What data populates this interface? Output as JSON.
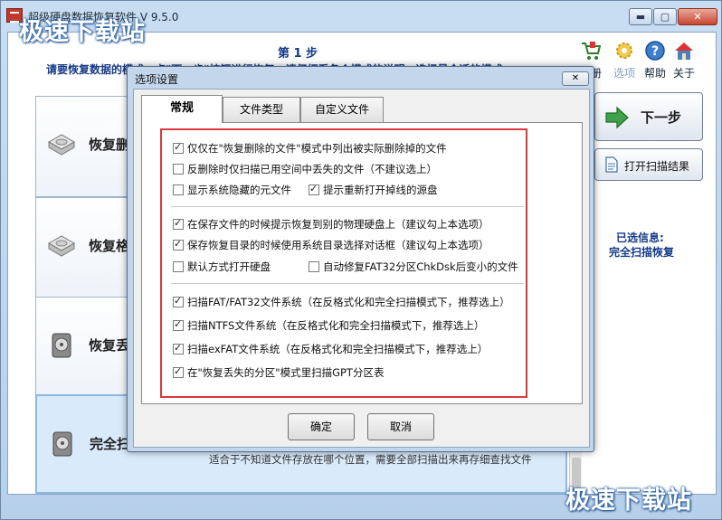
{
  "window": {
    "title": "超级硬盘数据恢复软件 V 9.5.0",
    "min_symbol": "▬",
    "max_symbol": "▢",
    "close_symbol": "✕"
  },
  "watermark": {
    "text": "极速下载站"
  },
  "header": {
    "step_title": "第 1 步",
    "instruction": "请要恢复数据的模式，点\"下一步\"按钮进行恢复，请仔细看各个模式的说明，选择最合适的模式"
  },
  "toolbar": {
    "register_label": "注册",
    "options_label": "选项",
    "help_label": "帮助",
    "about_label": "关于"
  },
  "modes": [
    {
      "label": "恢复删"
    },
    {
      "label": "恢复格"
    },
    {
      "label": "恢复丢"
    },
    {
      "label": "完全扫",
      "description": "适合于不知道文件存放在哪个位置，需要全部扫描出来再存细查找文件"
    }
  ],
  "actions": {
    "next_label": "下一步",
    "open_scan_label": "打开扫描结果"
  },
  "selected": {
    "label": "已选信息:",
    "value": "完全扫描恢复"
  },
  "dialog": {
    "title": "选项设置",
    "close_symbol": "✕",
    "tabs": [
      "常规",
      "文件类型",
      "自定义文件"
    ],
    "options": {
      "list_deleted_only": {
        "label": "仅仅在\"恢复删除的文件\"模式中列出被实际删除掉的文件",
        "checked": true
      },
      "scan_free_space": {
        "label": "反删除时仅扫描已用空间中丢失的文件（不建议选上）",
        "checked": false
      },
      "show_system_meta": {
        "label": "显示系统隐藏的元文件",
        "checked": false
      },
      "remind_reopen": {
        "label": "提示重新打开掉线的源盘",
        "checked": true
      },
      "prompt_other_disk": {
        "label": "在保存文件的时候提示恢复到别的物理硬盘上（建议勾上本选项）",
        "checked": true
      },
      "system_dir_dialog": {
        "label": "保存恢复目录的时候使用系统目录选择对话框（建议勾上本选项）",
        "checked": true
      },
      "default_open_disk": {
        "label": "默认方式打开硬盘",
        "checked": false
      },
      "auto_fix_fat32": {
        "label": "自动修复FAT32分区ChkDsk后变小的文件",
        "checked": false
      },
      "scan_fat": {
        "label": "扫描FAT/FAT32文件系统（在反格式化和完全扫描模式下，推荐选上）",
        "checked": true
      },
      "scan_ntfs": {
        "label": "扫描NTFS文件系统（在反格式化和完全扫描模式下，推荐选上）",
        "checked": true
      },
      "scan_exfat": {
        "label": "扫描exFAT文件系统（在反格式化和完全扫描模式下，推荐选上）",
        "checked": true
      },
      "scan_gpt": {
        "label": "在\"恢复丢失的分区\"模式里扫描GPT分区表",
        "checked": true
      }
    },
    "ok_label": "确定",
    "cancel_label": "取消"
  },
  "colors": {
    "accent": "#143a87",
    "highlight_border": "#d9393b"
  },
  "icons": {
    "register": "cart-icon",
    "options": "gear-icon",
    "help": "question-icon",
    "about": "house-icon"
  }
}
